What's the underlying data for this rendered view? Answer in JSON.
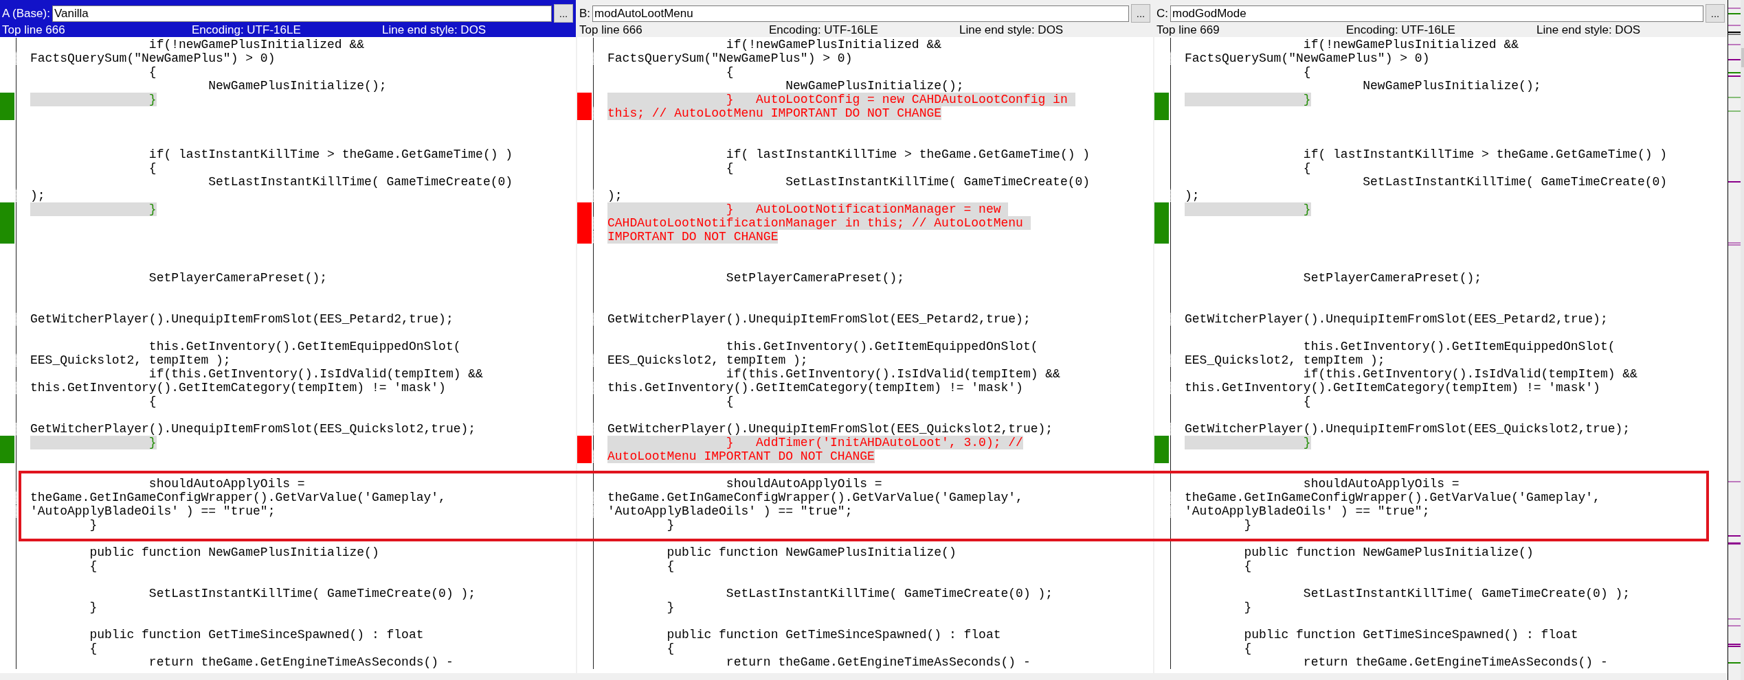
{
  "panes": [
    {
      "label": "A (Base):",
      "file": "Vanilla",
      "button": "...",
      "selected": true,
      "color": "#1e8c00",
      "top_line": "Top line 666",
      "encoding": "Encoding: UTF-16LE",
      "line_end": "Line end style: DOS",
      "rows": [
        {
          "text": "\t\tif(!newGamePlusInitialized &&",
          "wrap": false,
          "diff": false
        },
        {
          "text": "FactsQuerySum(\"NewGamePlus\") > 0)",
          "wrap": true,
          "diff": false
        },
        {
          "text": "\t\t{",
          "wrap": false,
          "diff": false
        },
        {
          "text": "\t\t\tNewGamePlusInitialize();",
          "wrap": false,
          "diff": false
        },
        {
          "text": "\t\t}",
          "wrap": false,
          "diff": true
        },
        {
          "text": "",
          "wrap": false,
          "diff": true
        },
        {
          "text": "",
          "wrap": false,
          "diff": false
        },
        {
          "text": "",
          "wrap": false,
          "diff": false
        },
        {
          "text": "\t\tif( lastInstantKillTime > theGame.GetGameTime() )",
          "wrap": false,
          "diff": false
        },
        {
          "text": "\t\t{",
          "wrap": false,
          "diff": false
        },
        {
          "text": "\t\t\tSetLastInstantKillTime( GameTimeCreate(0)",
          "wrap": false,
          "diff": false
        },
        {
          "text": ");",
          "wrap": true,
          "diff": false
        },
        {
          "text": "\t\t}",
          "wrap": false,
          "diff": true
        },
        {
          "text": "",
          "wrap": false,
          "diff": true
        },
        {
          "text": "",
          "wrap": false,
          "diff": true
        },
        {
          "text": "",
          "wrap": false,
          "diff": false
        },
        {
          "text": "",
          "wrap": false,
          "diff": false
        },
        {
          "text": "\t\tSetPlayerCameraPreset();",
          "wrap": false,
          "diff": false
        },
        {
          "text": "",
          "wrap": false,
          "diff": false
        },
        {
          "text": "",
          "wrap": false,
          "diff": false
        },
        {
          "text": "GetWitcherPlayer().UnequipItemFromSlot(EES_Petard2,true);",
          "wrap": true,
          "diff": false
        },
        {
          "text": "",
          "wrap": false,
          "diff": false
        },
        {
          "text": "\t\tthis.GetInventory().GetItemEquippedOnSlot(",
          "wrap": false,
          "diff": false
        },
        {
          "text": "EES_Quickslot2, tempItem );",
          "wrap": true,
          "diff": false
        },
        {
          "text": "\t\tif(this.GetInventory().IsIdValid(tempItem) &&",
          "wrap": false,
          "diff": false
        },
        {
          "text": "this.GetInventory().GetItemCategory(tempItem) != 'mask')",
          "wrap": true,
          "diff": false
        },
        {
          "text": "\t\t{",
          "wrap": false,
          "diff": false
        },
        {
          "text": "",
          "wrap": false,
          "diff": false
        },
        {
          "text": "GetWitcherPlayer().UnequipItemFromSlot(EES_Quickslot2,true);",
          "wrap": true,
          "diff": false
        },
        {
          "text": "\t\t}",
          "wrap": false,
          "diff": true
        },
        {
          "text": "",
          "wrap": false,
          "diff": true
        },
        {
          "text": "",
          "wrap": false,
          "diff": false
        },
        {
          "text": "\t\tshouldAutoApplyOils =",
          "wrap": false,
          "diff": false
        },
        {
          "text": "theGame.GetInGameConfigWrapper().GetVarValue('Gameplay',",
          "wrap": true,
          "diff": false
        },
        {
          "text": "'AutoApplyBladeOils' ) == \"true\";",
          "wrap": true,
          "diff": false
        },
        {
          "text": "\t}",
          "wrap": false,
          "diff": false
        },
        {
          "text": "",
          "wrap": false,
          "diff": false
        },
        {
          "text": "\tpublic function NewGamePlusInitialize()",
          "wrap": false,
          "diff": false
        },
        {
          "text": "\t{",
          "wrap": false,
          "diff": false
        },
        {
          "text": "",
          "wrap": false,
          "diff": false
        },
        {
          "text": "\t\tSetLastInstantKillTime( GameTimeCreate(0) );",
          "wrap": false,
          "diff": false
        },
        {
          "text": "\t}",
          "wrap": false,
          "diff": false
        },
        {
          "text": "",
          "wrap": false,
          "diff": false
        },
        {
          "text": "\tpublic function GetTimeSinceSpawned() : float",
          "wrap": false,
          "diff": false
        },
        {
          "text": "\t{",
          "wrap": false,
          "diff": false
        },
        {
          "text": "\t\treturn theGame.GetEngineTimeAsSeconds() -",
          "wrap": false,
          "diff": false
        }
      ]
    },
    {
      "label": "B:",
      "file": "modAutoLootMenu",
      "button": "...",
      "selected": false,
      "color": "#ff0000",
      "top_line": "Top line 666",
      "encoding": "Encoding: UTF-16LE",
      "line_end": "Line end style: DOS",
      "rows": [
        {
          "text": "\t\tif(!newGamePlusInitialized &&",
          "wrap": false,
          "diff": false
        },
        {
          "text": "FactsQuerySum(\"NewGamePlus\") > 0)",
          "wrap": true,
          "diff": false
        },
        {
          "text": "\t\t{",
          "wrap": false,
          "diff": false
        },
        {
          "text": "\t\t\tNewGamePlusInitialize();",
          "wrap": false,
          "diff": false
        },
        {
          "text": "\t\t}   AutoLootConfig = new CAHDAutoLootConfig in ",
          "wrap": false,
          "diff": true
        },
        {
          "text": "this; // AutoLootMenu IMPORTANT DO NOT CHANGE",
          "wrap": true,
          "diff": true
        },
        {
          "text": "",
          "wrap": false,
          "diff": false
        },
        {
          "text": "",
          "wrap": false,
          "diff": false
        },
        {
          "text": "\t\tif( lastInstantKillTime > theGame.GetGameTime() )",
          "wrap": false,
          "diff": false
        },
        {
          "text": "\t\t{",
          "wrap": false,
          "diff": false
        },
        {
          "text": "\t\t\tSetLastInstantKillTime( GameTimeCreate(0)",
          "wrap": false,
          "diff": false
        },
        {
          "text": ");",
          "wrap": true,
          "diff": false
        },
        {
          "text": "\t\t}   AutoLootNotificationManager = new ",
          "wrap": false,
          "diff": true
        },
        {
          "text": "CAHDAutoLootNotificationManager in this; // AutoLootMenu ",
          "wrap": true,
          "diff": true
        },
        {
          "text": "IMPORTANT DO NOT CHANGE",
          "wrap": true,
          "diff": true
        },
        {
          "text": "",
          "wrap": false,
          "diff": false
        },
        {
          "text": "",
          "wrap": false,
          "diff": false
        },
        {
          "text": "\t\tSetPlayerCameraPreset();",
          "wrap": false,
          "diff": false
        },
        {
          "text": "",
          "wrap": false,
          "diff": false
        },
        {
          "text": "",
          "wrap": false,
          "diff": false
        },
        {
          "text": "GetWitcherPlayer().UnequipItemFromSlot(EES_Petard2,true);",
          "wrap": true,
          "diff": false
        },
        {
          "text": "",
          "wrap": false,
          "diff": false
        },
        {
          "text": "\t\tthis.GetInventory().GetItemEquippedOnSlot(",
          "wrap": false,
          "diff": false
        },
        {
          "text": "EES_Quickslot2, tempItem );",
          "wrap": true,
          "diff": false
        },
        {
          "text": "\t\tif(this.GetInventory().IsIdValid(tempItem) &&",
          "wrap": false,
          "diff": false
        },
        {
          "text": "this.GetInventory().GetItemCategory(tempItem) != 'mask')",
          "wrap": true,
          "diff": false
        },
        {
          "text": "\t\t{",
          "wrap": false,
          "diff": false
        },
        {
          "text": "",
          "wrap": false,
          "diff": false
        },
        {
          "text": "GetWitcherPlayer().UnequipItemFromSlot(EES_Quickslot2,true);",
          "wrap": true,
          "diff": false
        },
        {
          "text": "\t\t}   AddTimer('InitAHDAutoLoot', 3.0); //",
          "wrap": false,
          "diff": true
        },
        {
          "text": "AutoLootMenu IMPORTANT DO NOT CHANGE",
          "wrap": true,
          "diff": true
        },
        {
          "text": "",
          "wrap": false,
          "diff": false
        },
        {
          "text": "\t\tshouldAutoApplyOils =",
          "wrap": false,
          "diff": false
        },
        {
          "text": "theGame.GetInGameConfigWrapper().GetVarValue('Gameplay',",
          "wrap": true,
          "diff": false
        },
        {
          "text": "'AutoApplyBladeOils' ) == \"true\";",
          "wrap": true,
          "diff": false
        },
        {
          "text": "\t}",
          "wrap": false,
          "diff": false
        },
        {
          "text": "",
          "wrap": false,
          "diff": false
        },
        {
          "text": "\tpublic function NewGamePlusInitialize()",
          "wrap": false,
          "diff": false
        },
        {
          "text": "\t{",
          "wrap": false,
          "diff": false
        },
        {
          "text": "",
          "wrap": false,
          "diff": false
        },
        {
          "text": "\t\tSetLastInstantKillTime( GameTimeCreate(0) );",
          "wrap": false,
          "diff": false
        },
        {
          "text": "\t}",
          "wrap": false,
          "diff": false
        },
        {
          "text": "",
          "wrap": false,
          "diff": false
        },
        {
          "text": "\tpublic function GetTimeSinceSpawned() : float",
          "wrap": false,
          "diff": false
        },
        {
          "text": "\t{",
          "wrap": false,
          "diff": false
        },
        {
          "text": "\t\treturn theGame.GetEngineTimeAsSeconds() -",
          "wrap": false,
          "diff": false
        }
      ]
    },
    {
      "label": "C:",
      "file": "modGodMode",
      "button": "...",
      "selected": false,
      "color": "#1e8c00",
      "top_line": "Top line 669",
      "encoding": "Encoding: UTF-16LE",
      "line_end": "Line end style: DOS",
      "rows": [
        {
          "text": "\t\tif(!newGamePlusInitialized &&",
          "wrap": false,
          "diff": false
        },
        {
          "text": "FactsQuerySum(\"NewGamePlus\") > 0)",
          "wrap": true,
          "diff": false
        },
        {
          "text": "\t\t{",
          "wrap": false,
          "diff": false
        },
        {
          "text": "\t\t\tNewGamePlusInitialize();",
          "wrap": false,
          "diff": false
        },
        {
          "text": "\t\t}",
          "wrap": false,
          "diff": true
        },
        {
          "text": "",
          "wrap": false,
          "diff": true
        },
        {
          "text": "",
          "wrap": false,
          "diff": false
        },
        {
          "text": "",
          "wrap": false,
          "diff": false
        },
        {
          "text": "\t\tif( lastInstantKillTime > theGame.GetGameTime() )",
          "wrap": false,
          "diff": false
        },
        {
          "text": "\t\t{",
          "wrap": false,
          "diff": false
        },
        {
          "text": "\t\t\tSetLastInstantKillTime( GameTimeCreate(0)",
          "wrap": false,
          "diff": false
        },
        {
          "text": ");",
          "wrap": true,
          "diff": false
        },
        {
          "text": "\t\t}",
          "wrap": false,
          "diff": true
        },
        {
          "text": "",
          "wrap": false,
          "diff": true
        },
        {
          "text": "",
          "wrap": false,
          "diff": true
        },
        {
          "text": "",
          "wrap": false,
          "diff": false
        },
        {
          "text": "",
          "wrap": false,
          "diff": false
        },
        {
          "text": "\t\tSetPlayerCameraPreset();",
          "wrap": false,
          "diff": false
        },
        {
          "text": "",
          "wrap": false,
          "diff": false
        },
        {
          "text": "",
          "wrap": false,
          "diff": false
        },
        {
          "text": "GetWitcherPlayer().UnequipItemFromSlot(EES_Petard2,true);",
          "wrap": true,
          "diff": false
        },
        {
          "text": "",
          "wrap": false,
          "diff": false
        },
        {
          "text": "\t\tthis.GetInventory().GetItemEquippedOnSlot(",
          "wrap": false,
          "diff": false
        },
        {
          "text": "EES_Quickslot2, tempItem );",
          "wrap": true,
          "diff": false
        },
        {
          "text": "\t\tif(this.GetInventory().IsIdValid(tempItem) &&",
          "wrap": false,
          "diff": false
        },
        {
          "text": "this.GetInventory().GetItemCategory(tempItem) != 'mask')",
          "wrap": true,
          "diff": false
        },
        {
          "text": "\t\t{",
          "wrap": false,
          "diff": false
        },
        {
          "text": "",
          "wrap": false,
          "diff": false
        },
        {
          "text": "GetWitcherPlayer().UnequipItemFromSlot(EES_Quickslot2,true);",
          "wrap": true,
          "diff": false
        },
        {
          "text": "\t\t}",
          "wrap": false,
          "diff": true
        },
        {
          "text": "",
          "wrap": false,
          "diff": true
        },
        {
          "text": "",
          "wrap": false,
          "diff": false
        },
        {
          "text": "\t\tshouldAutoApplyOils =",
          "wrap": false,
          "diff": false
        },
        {
          "text": "theGame.GetInGameConfigWrapper().GetVarValue('Gameplay',",
          "wrap": true,
          "diff": false
        },
        {
          "text": "'AutoApplyBladeOils' ) == \"true\";",
          "wrap": true,
          "diff": false
        },
        {
          "text": "\t}",
          "wrap": false,
          "diff": false
        },
        {
          "text": "",
          "wrap": false,
          "diff": false
        },
        {
          "text": "\tpublic function NewGamePlusInitialize()",
          "wrap": false,
          "diff": false
        },
        {
          "text": "\t{",
          "wrap": false,
          "diff": false
        },
        {
          "text": "",
          "wrap": false,
          "diff": false
        },
        {
          "text": "\t\tSetLastInstantKillTime( GameTimeCreate(0) );",
          "wrap": false,
          "diff": false
        },
        {
          "text": "\t}",
          "wrap": false,
          "diff": false
        },
        {
          "text": "",
          "wrap": false,
          "diff": false
        },
        {
          "text": "\tpublic function GetTimeSinceSpawned() : float",
          "wrap": false,
          "diff": false
        },
        {
          "text": "\t{",
          "wrap": false,
          "diff": false
        },
        {
          "text": "\t\treturn theGame.GetEngineTimeAsSeconds() -",
          "wrap": false,
          "diff": false
        }
      ]
    }
  ]
}
